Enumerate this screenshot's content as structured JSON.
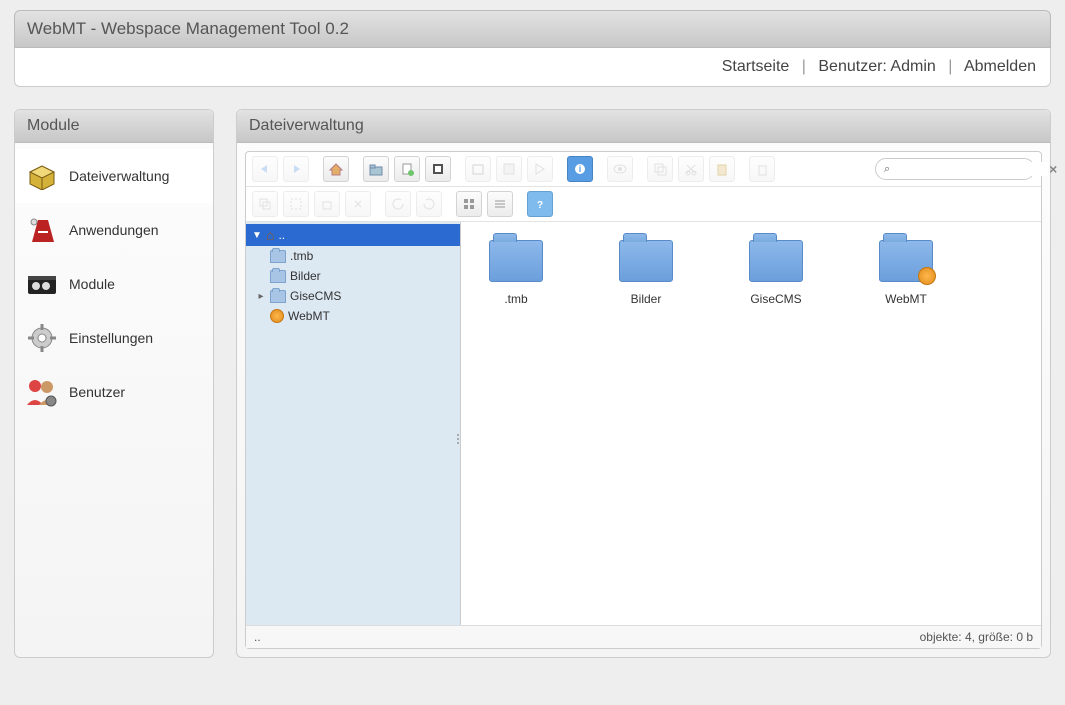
{
  "header": {
    "title": "WebMT - Webspace Management Tool 0.2",
    "links": {
      "home": "Startseite",
      "user_prefix": "Benutzer:",
      "user_name": "Admin",
      "logout": "Abmelden"
    }
  },
  "sidebar": {
    "title": "Module",
    "items": [
      {
        "label": "Dateiverwaltung",
        "icon": "box",
        "active": true
      },
      {
        "label": "Anwendungen",
        "icon": "app"
      },
      {
        "label": "Module",
        "icon": "module"
      },
      {
        "label": "Einstellungen",
        "icon": "gear"
      },
      {
        "label": "Benutzer",
        "icon": "users"
      }
    ]
  },
  "content": {
    "title": "Dateiverwaltung"
  },
  "tree": {
    "root": "..",
    "items": [
      {
        "label": ".tmb"
      },
      {
        "label": "Bilder"
      },
      {
        "label": "GiseCMS",
        "expandable": true
      },
      {
        "label": "WebMT",
        "readonly": true
      }
    ]
  },
  "folders": [
    {
      "label": ".tmb"
    },
    {
      "label": "Bilder"
    },
    {
      "label": "GiseCMS"
    },
    {
      "label": "WebMT",
      "readonly": true
    }
  ],
  "status": {
    "path": "..",
    "info": "objekte: 4, größe: 0 b"
  },
  "search": {
    "placeholder": ""
  }
}
